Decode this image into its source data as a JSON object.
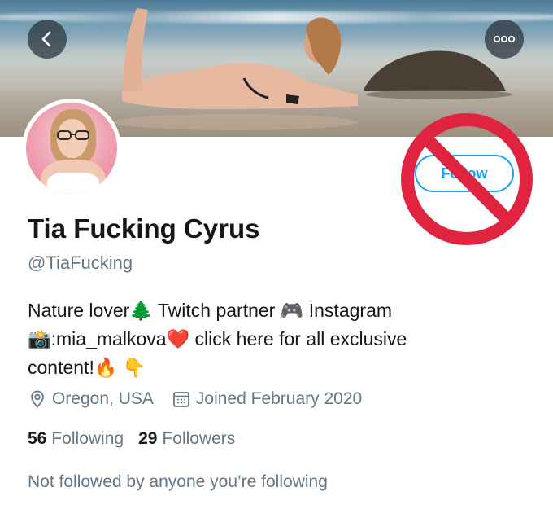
{
  "profile": {
    "display_name": "Tia Fucking Cyrus",
    "handle": "@TiaFucking",
    "bio": {
      "line1": "Nature lover🌲 Twitch partner 🎮 Instagram",
      "line2": "📸:mia_malkova❤️ click here for all exclusive",
      "line3": "content!🔥 👇"
    },
    "location": "Oregon, USA",
    "joined": "Joined February 2020",
    "following_count": "56",
    "following_label": "Following",
    "followers_count": "29",
    "followers_label": "Followers",
    "followed_by_text": "Not followed by anyone you’re following"
  },
  "actions": {
    "follow_label": "Follow",
    "back_icon": "chevron-left-icon",
    "more_icon": "more-horizontal-icon"
  },
  "overlay": {
    "icon": "prohibited-icon",
    "color": "#e0243f"
  },
  "colors": {
    "accent": "#1da1f2",
    "secondary_text": "#657786",
    "primary_text": "#14171a"
  }
}
